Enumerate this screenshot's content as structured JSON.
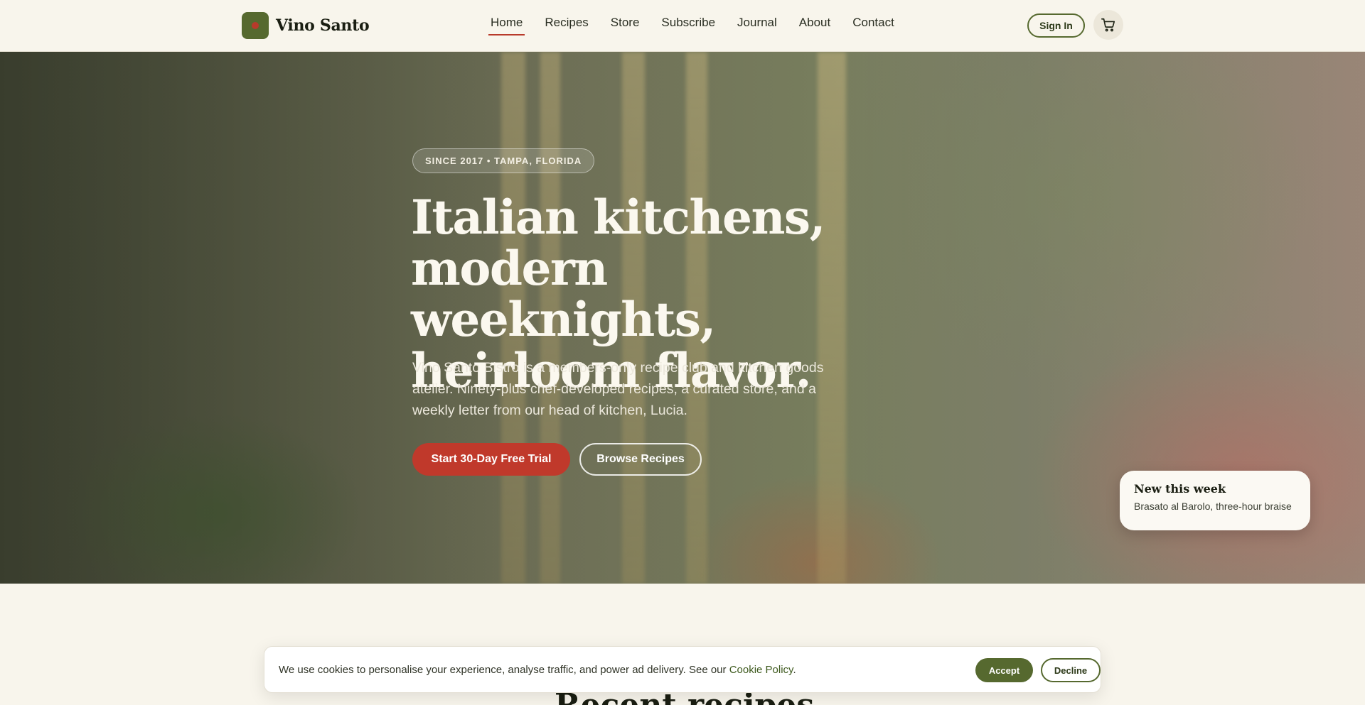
{
  "header": {
    "brand_name": "Vino Santo",
    "nav": [
      {
        "label": "Home",
        "active": true
      },
      {
        "label": "Recipes"
      },
      {
        "label": "Store"
      },
      {
        "label": "Subscribe"
      },
      {
        "label": "Journal"
      },
      {
        "label": "About"
      },
      {
        "label": "Contact"
      }
    ],
    "sign_in_label": "Sign In",
    "cart_icon": "cart-icon"
  },
  "hero": {
    "badge": "SINCE 2017 • TAMPA, FLORIDA",
    "title": "Italian kitchens, modern weeknights, heirloom flavor.",
    "copy": "Vino Santo Bistro is a members-only recipe club and kitchen goods atelier. Ninety-plus chef-developed recipes, a curated store, and a weekly letter from our head of kitchen, Lucia.",
    "primary_cta": "Start 30-Day Free Trial",
    "secondary_cta": "Browse Recipes"
  },
  "new_card": {
    "title": "New this week",
    "subtitle": "Brasato al Barolo, three-hour braise"
  },
  "section_peek": {
    "title": "Recent recipes"
  },
  "cookie": {
    "text": "We use cookies to personalise your experience, analyse traffic, and power ad delivery. See our ",
    "link": "Cookie Policy",
    "text_end": ".",
    "accept": "Accept",
    "decline": "Decline"
  },
  "colors": {
    "accent_green": "#56692f",
    "accent_red": "#c0392b",
    "background": "#f8f5ec"
  }
}
